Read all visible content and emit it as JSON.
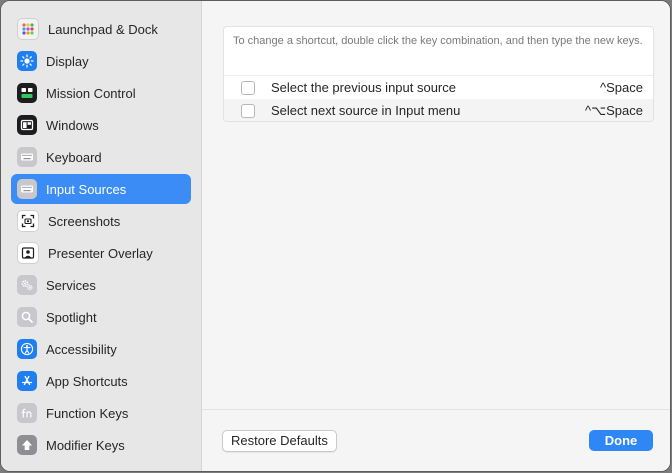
{
  "sidebar": {
    "items": [
      {
        "label": "Launchpad & Dock",
        "icon": "launchpad-icon",
        "selected": false
      },
      {
        "label": "Display",
        "icon": "display-brightness-icon",
        "selected": false
      },
      {
        "label": "Mission Control",
        "icon": "mission-control-icon",
        "selected": false
      },
      {
        "label": "Windows",
        "icon": "windows-icon",
        "selected": false
      },
      {
        "label": "Keyboard",
        "icon": "keyboard-icon",
        "selected": false
      },
      {
        "label": "Input Sources",
        "icon": "input-sources-icon",
        "selected": true
      },
      {
        "label": "Screenshots",
        "icon": "screenshot-icon",
        "selected": false
      },
      {
        "label": "Presenter Overlay",
        "icon": "presenter-overlay-icon",
        "selected": false
      },
      {
        "label": "Services",
        "icon": "services-gears-icon",
        "selected": false
      },
      {
        "label": "Spotlight",
        "icon": "spotlight-magnifier-icon",
        "selected": false
      },
      {
        "label": "Accessibility",
        "icon": "accessibility-icon",
        "selected": false
      },
      {
        "label": "App Shortcuts",
        "icon": "app-store-icon",
        "selected": false
      },
      {
        "label": "Function Keys",
        "icon": "fn-key-icon",
        "selected": false
      },
      {
        "label": "Modifier Keys",
        "icon": "modifier-arrow-icon",
        "selected": false
      }
    ]
  },
  "main": {
    "hint": "To change a shortcut, double click the key combination, and then type the new keys.",
    "shortcuts": [
      {
        "label": "Select the previous input source",
        "keys": "^Space",
        "checked": false
      },
      {
        "label": "Select next source in Input menu",
        "keys": "^⌥Space",
        "checked": false
      }
    ]
  },
  "footer": {
    "restore_label": "Restore Defaults",
    "done_label": "Done"
  },
  "colors": {
    "accent": "#3b8cf5",
    "sidebar_bg": "#e7e7e7",
    "main_bg": "#f5f5f5"
  }
}
